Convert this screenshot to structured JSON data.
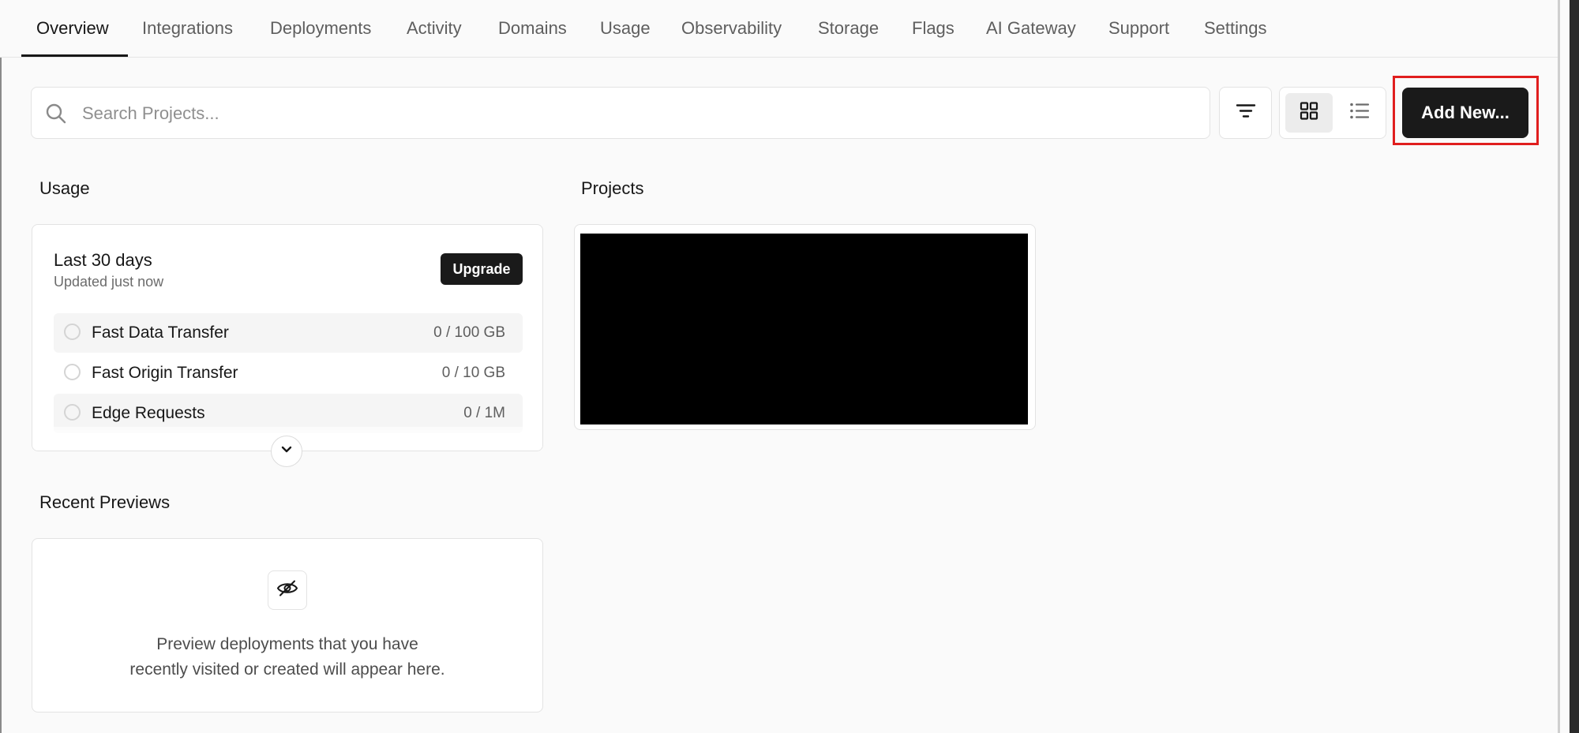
{
  "tabs": [
    {
      "label": "Overview",
      "active": true
    },
    {
      "label": "Integrations"
    },
    {
      "label": "Deployments"
    },
    {
      "label": "Activity"
    },
    {
      "label": "Domains"
    },
    {
      "label": "Usage"
    },
    {
      "label": "Observability"
    },
    {
      "label": "Storage"
    },
    {
      "label": "Flags"
    },
    {
      "label": "AI Gateway"
    },
    {
      "label": "Support"
    },
    {
      "label": "Settings"
    }
  ],
  "toolbar": {
    "search_placeholder": "Search Projects...",
    "search_value": "",
    "add_new_label": "Add New...",
    "view_mode": "grid",
    "icons": {
      "search": "search-icon",
      "filter": "filter-icon",
      "grid": "grid-icon",
      "list": "list-icon"
    }
  },
  "usage": {
    "title": "Usage",
    "period": "Last 30 days",
    "updated": "Updated just now",
    "upgrade_label": "Upgrade",
    "items": [
      {
        "label": "Fast Data Transfer",
        "value": "0 / 100 GB"
      },
      {
        "label": "Fast Origin Transfer",
        "value": "0 / 10 GB"
      },
      {
        "label": "Edge Requests",
        "value": "0 / 1M"
      }
    ]
  },
  "projects": {
    "title": "Projects"
  },
  "recent_previews": {
    "title": "Recent Previews",
    "message_line1": "Preview deployments that you have",
    "message_line2": "recently visited or created will appear here."
  },
  "colors": {
    "background": "#fafafa",
    "primary_button": "#1a1a1a",
    "highlight": "#e01e1e"
  }
}
